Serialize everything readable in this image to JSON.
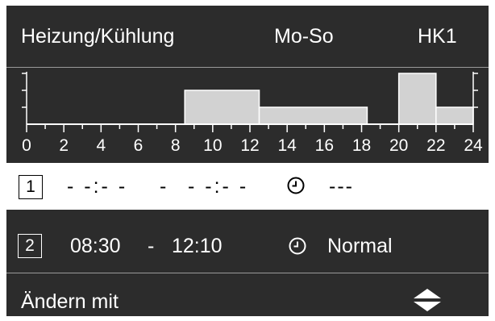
{
  "header": {
    "title": "Heizung/Kühlung",
    "days": "Mo-So",
    "circuit": "HK1"
  },
  "chart_data": {
    "type": "bar",
    "title": "",
    "xlabel": "",
    "ylabel": "",
    "xlim": [
      0,
      24
    ],
    "ylim": [
      0,
      3
    ],
    "x_tick_labels": [
      "0",
      "2",
      "4",
      "6",
      "8",
      "10",
      "12",
      "14",
      "16",
      "18",
      "20",
      "22",
      "24"
    ],
    "bars": [
      {
        "start": 8.5,
        "end": 12.5,
        "level": 2
      },
      {
        "start": 12.5,
        "end": 18.3,
        "level": 1
      },
      {
        "start": 20.0,
        "end": 22.0,
        "level": 3
      },
      {
        "start": 22.0,
        "end": 24.0,
        "level": 1
      }
    ],
    "colors": {
      "bar_fill": "#d2d2d2",
      "axis": "#ffffff"
    }
  },
  "periods": [
    {
      "number": "1",
      "start": "- -:- -",
      "separator": "-",
      "end": "- -:- -",
      "mode": "---",
      "selected": true
    },
    {
      "number": "2",
      "start": "08:30",
      "separator": "-",
      "end": "12:10",
      "mode": "Normal",
      "selected": false
    }
  ],
  "footer": {
    "label": "Ändern mit",
    "icon": "up-down-arrows-icon"
  },
  "colors": {
    "background": "#2c2c2c",
    "text": "#ffffff",
    "selection": "#ffffff",
    "separator": "#9a9a9a"
  }
}
